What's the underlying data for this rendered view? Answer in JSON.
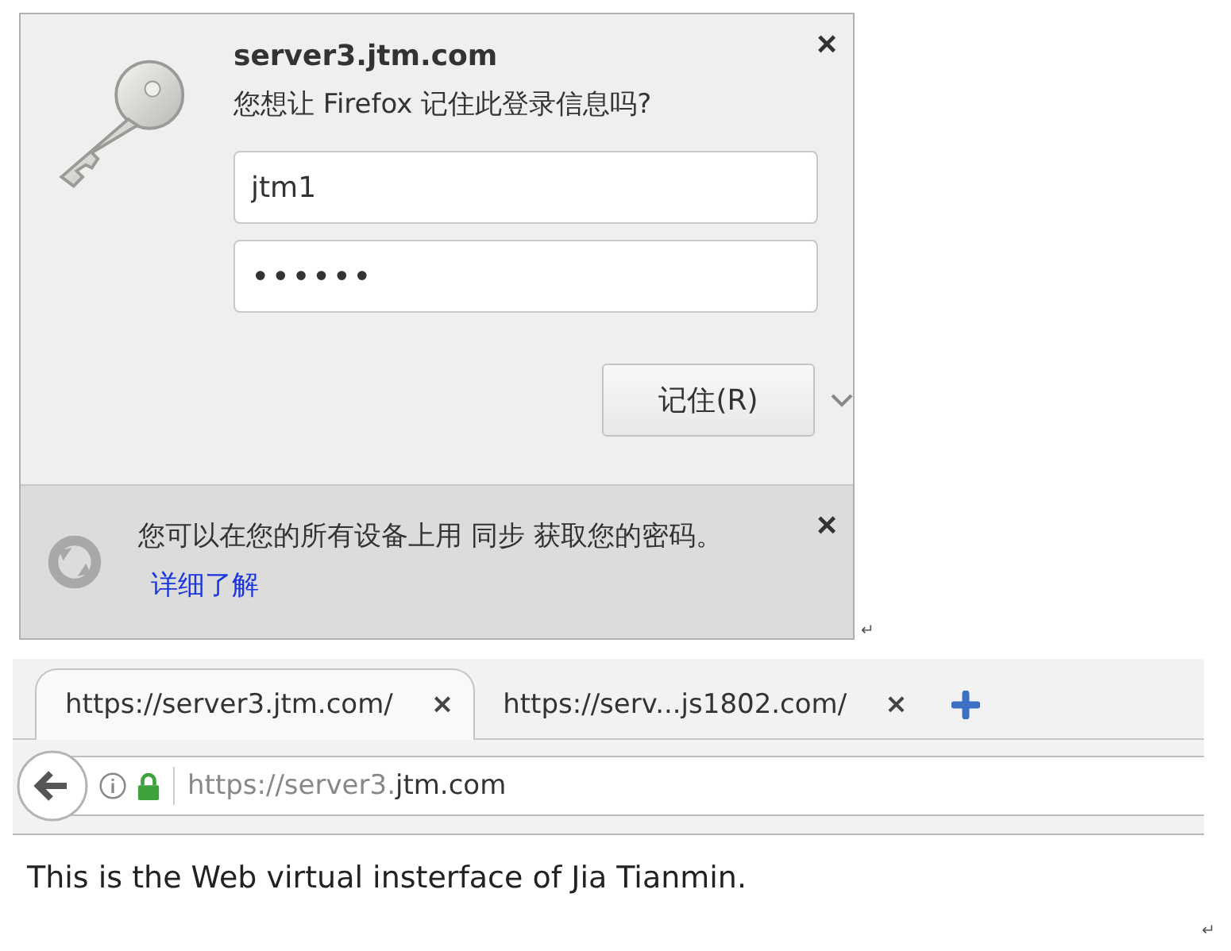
{
  "popup": {
    "site": "server3.jtm.com",
    "question": "您想让 Firefox 记住此登录信息吗?",
    "username": "jtm1",
    "password": "••••••",
    "remember_button": "记住(R)",
    "close": "×"
  },
  "sync_notice": {
    "text": "您可以在您的所有设备上用 同步 获取您的密码。",
    "link": "详细了解",
    "close": "×"
  },
  "tabs": [
    {
      "label": "https://server3.jtm.com/",
      "selected": true,
      "close": "×"
    },
    {
      "label": "https://serv...js1802.com/",
      "selected": false,
      "close": "×"
    }
  ],
  "address": {
    "url_prefix": "https://server3.",
    "url_domain": "jtm.com"
  },
  "page_text": "This is the Web virtual insterface of Jia Tianmin.",
  "marks": [
    "↵",
    "↵"
  ]
}
